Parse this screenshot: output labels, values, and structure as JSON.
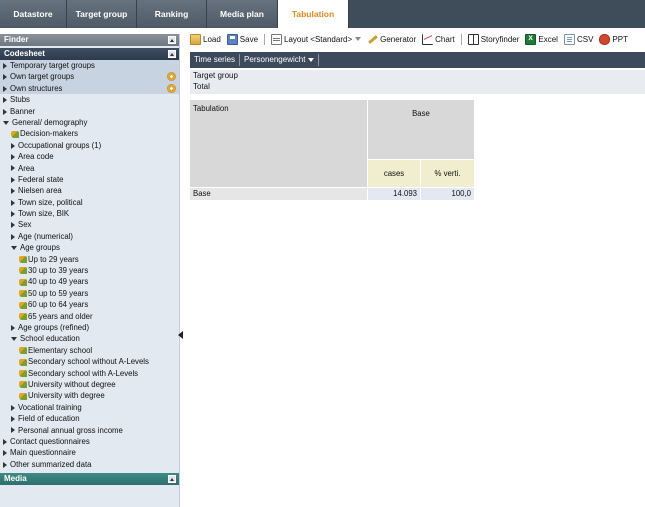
{
  "tabs": [
    "Datastore",
    "Target group",
    "Ranking",
    "Media plan",
    "Tabulation"
  ],
  "sidebar": {
    "finder_title": "Finder",
    "codesheet_title": "Codesheet",
    "media_title": "Media",
    "items": [
      {
        "label": "Temporary target groups",
        "icon": "arrow-right",
        "indent": 0,
        "shaded": true
      },
      {
        "label": "Own target groups",
        "icon": "arrow-right",
        "indent": 0,
        "shaded": true,
        "gear": true
      },
      {
        "label": "Own structures",
        "icon": "arrow-right",
        "indent": 0,
        "shaded": true,
        "gear": true
      },
      {
        "label": "Stubs",
        "icon": "arrow-right",
        "indent": 0
      },
      {
        "label": "Banner",
        "icon": "arrow-right",
        "indent": 0
      },
      {
        "label": "General/ demography",
        "icon": "arrow-down",
        "indent": 0
      },
      {
        "label": "Decision-makers",
        "icon": "leaf",
        "indent": 1
      },
      {
        "label": "Occupational groups (1)",
        "icon": "arrow-right",
        "indent": 1
      },
      {
        "label": "Area code",
        "icon": "arrow-right",
        "indent": 1
      },
      {
        "label": "Area",
        "icon": "arrow-right",
        "indent": 1
      },
      {
        "label": "Federal state",
        "icon": "arrow-right",
        "indent": 1
      },
      {
        "label": "Nielsen area",
        "icon": "arrow-right",
        "indent": 1
      },
      {
        "label": "Town size, political",
        "icon": "arrow-right",
        "indent": 1
      },
      {
        "label": "Town size, BIK",
        "icon": "arrow-right",
        "indent": 1
      },
      {
        "label": "Sex",
        "icon": "arrow-right",
        "indent": 1
      },
      {
        "label": "Age (numerical)",
        "icon": "arrow-right",
        "indent": 1
      },
      {
        "label": "Age groups",
        "icon": "arrow-down",
        "indent": 1
      },
      {
        "label": "Up to 29 years",
        "icon": "leaf",
        "indent": 2
      },
      {
        "label": "30 up to 39 years",
        "icon": "leaf",
        "indent": 2
      },
      {
        "label": "40 up to 49 years",
        "icon": "leaf",
        "indent": 2
      },
      {
        "label": "50 up to 59 years",
        "icon": "leaf",
        "indent": 2
      },
      {
        "label": "60 up to 64 years",
        "icon": "leaf",
        "indent": 2
      },
      {
        "label": "65 years and older",
        "icon": "leaf",
        "indent": 2
      },
      {
        "label": "Age groups (refined)",
        "icon": "arrow-right",
        "indent": 1
      },
      {
        "label": "School education",
        "icon": "arrow-down",
        "indent": 1
      },
      {
        "label": "Elementary school",
        "icon": "leaf",
        "indent": 2
      },
      {
        "label": "Secondary school without A-Levels",
        "icon": "leaf",
        "indent": 2
      },
      {
        "label": "Secondary school with A-Levels",
        "icon": "leaf",
        "indent": 2
      },
      {
        "label": "University without degree",
        "icon": "leaf",
        "indent": 2
      },
      {
        "label": "University with degree",
        "icon": "leaf",
        "indent": 2
      },
      {
        "label": "Vocational training",
        "icon": "arrow-right",
        "indent": 1
      },
      {
        "label": "Field of education",
        "icon": "arrow-right",
        "indent": 1
      },
      {
        "label": "Personal annual gross income",
        "icon": "arrow-right",
        "indent": 1
      },
      {
        "label": "Contact questionnaires",
        "icon": "arrow-right",
        "indent": 0
      },
      {
        "label": "Main questionnaire",
        "icon": "arrow-right",
        "indent": 0
      },
      {
        "label": "Other summarized data",
        "icon": "arrow-right",
        "indent": 0
      }
    ]
  },
  "toolbar": {
    "load": "Load",
    "save": "Save",
    "layout": "Layout",
    "layout_value": "<Standard>",
    "generator": "Generator",
    "chart": "Chart",
    "storyfinder": "Storyfinder",
    "excel": "Excel",
    "csv": "CSV",
    "ppt": "PPT"
  },
  "timeseries": {
    "label": "Time series",
    "weight": "Personengewicht"
  },
  "info": {
    "target_group_label": "Target group",
    "target_group_value": "Total"
  },
  "table": {
    "corner_label": "Tabulation",
    "column_group": "Base",
    "columns": [
      "cases",
      "% verti."
    ],
    "rows": [
      {
        "label": "Base",
        "cases": "14.093",
        "pct": "100,0"
      }
    ]
  }
}
